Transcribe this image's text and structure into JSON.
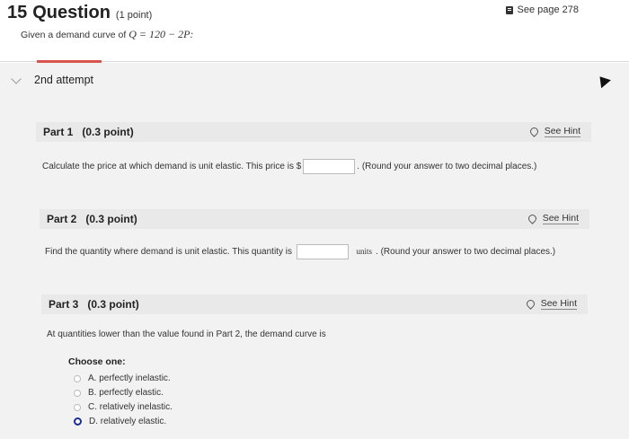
{
  "question": {
    "number": "15",
    "title": "Question",
    "points": "(1 point)",
    "see_page": "See page 278",
    "given_prefix": "Given a demand curve of ",
    "given_math": "Q = 120 − 2P:"
  },
  "attempt": {
    "label": "2nd attempt"
  },
  "parts": [
    {
      "label": "Part 1",
      "points": "(0.3 point)",
      "hint": "See Hint",
      "text": "Calculate the price at which demand is unit elastic. This price is  $",
      "suffix": ". (Round your answer to two decimal places.)"
    },
    {
      "label": "Part 2",
      "points": "(0.3 point)",
      "hint": "See Hint",
      "text": "Find the quantity where demand is unit elastic. This quantity is",
      "units": "units",
      "suffix": ". (Round your answer to two decimal places.)"
    },
    {
      "label": "Part 3",
      "points": "(0.3 point)",
      "hint": "See Hint",
      "text": "At quantities lower than the value found in Part 2, the demand curve is",
      "choose": "Choose one:",
      "options": [
        {
          "label": "A. perfectly inelastic.",
          "selected": false
        },
        {
          "label": "B. perfectly elastic.",
          "selected": false
        },
        {
          "label": "C. relatively inelastic.",
          "selected": false
        },
        {
          "label": "D. relatively elastic.",
          "selected": true
        }
      ]
    }
  ],
  "colors": {
    "accent_tab": "#d9534f",
    "selected_radio": "#1a2f8f"
  }
}
